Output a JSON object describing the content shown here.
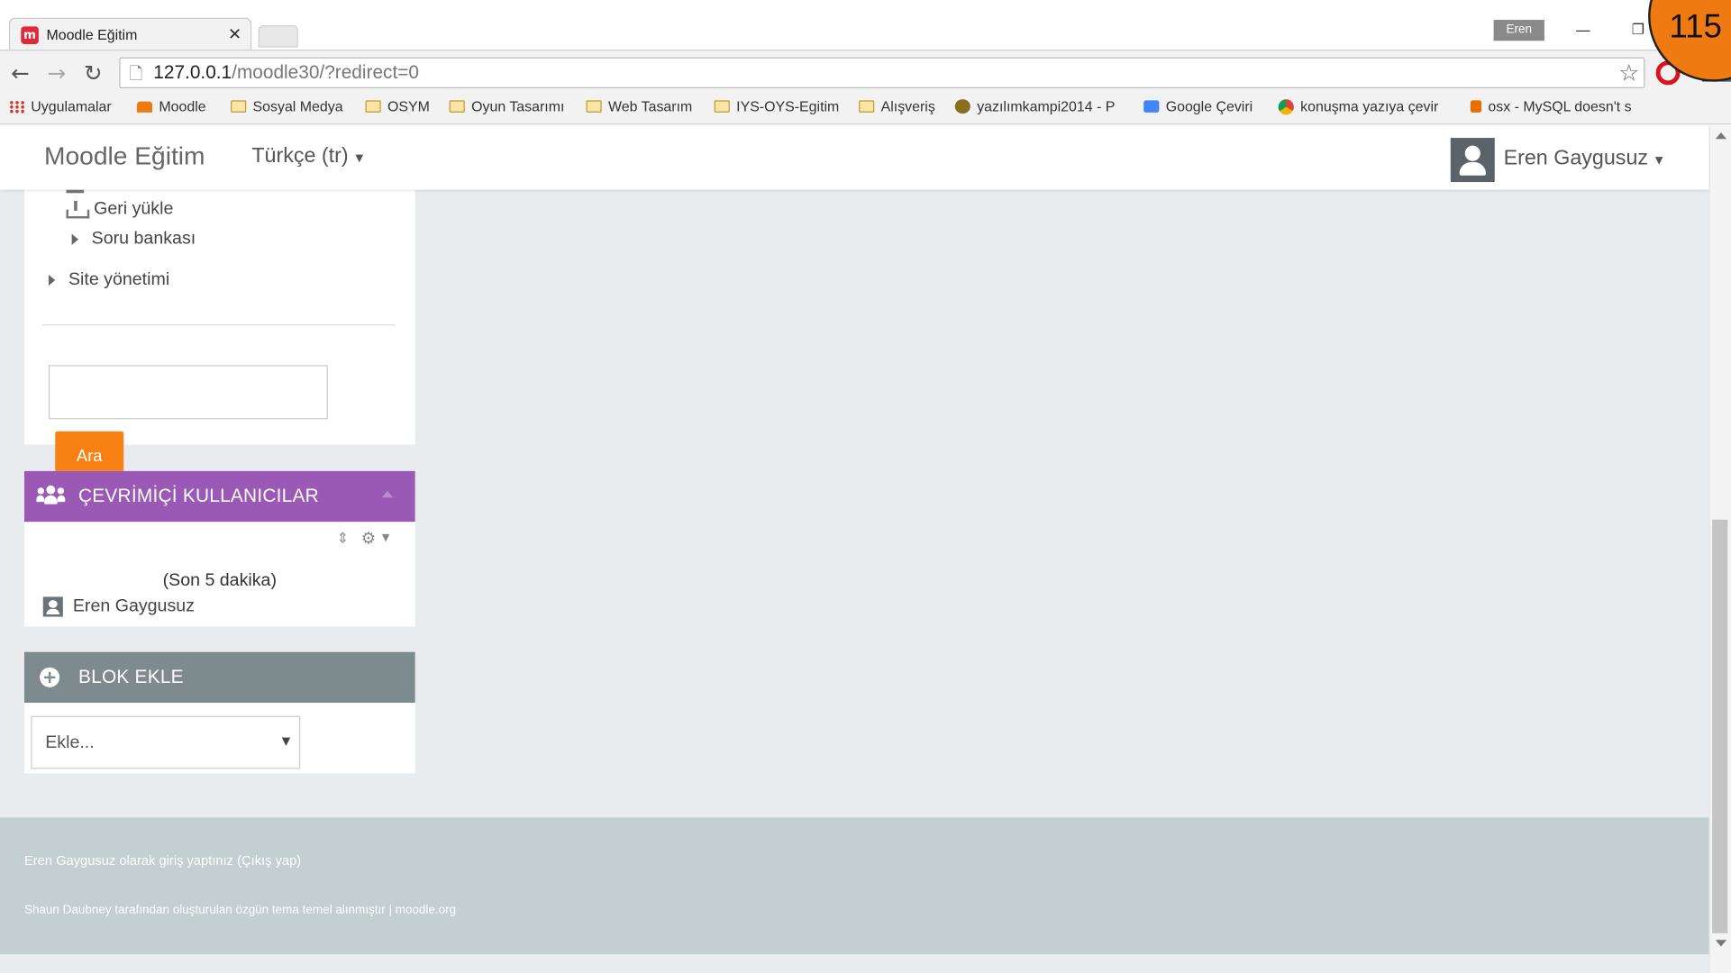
{
  "browser": {
    "tab_title": "Moodle Eğitim",
    "tab_favicon_letter": "m",
    "tab_close": "✕",
    "profile_name": "Eren",
    "window_min": "—",
    "window_max": "❐",
    "url_host": "127.0.0.1",
    "url_path": "/moodle30/?redirect=0",
    "nav_back": "←",
    "nav_forward": "→",
    "nav_reload": "↻",
    "bookmarks": [
      {
        "label": "Uygulamalar",
        "icon": "apps-grid-icon"
      },
      {
        "label": "Moodle",
        "icon": "moodle-icon"
      },
      {
        "label": "Sosyal Medya",
        "icon": "folder-icon"
      },
      {
        "label": "OSYM",
        "icon": "folder-icon"
      },
      {
        "label": "Oyun Tasarımı",
        "icon": "folder-icon"
      },
      {
        "label": "Web Tasarım",
        "icon": "folder-icon"
      },
      {
        "label": "IYS-OYS-Egitim",
        "icon": "folder-icon"
      },
      {
        "label": "Alışveriş",
        "icon": "folder-icon"
      },
      {
        "label": "yazılımkampi2014 - P",
        "icon": "bug-icon"
      },
      {
        "label": "Google Çeviri",
        "icon": "google-translate-icon"
      },
      {
        "label": "konuşma yazıya çevir",
        "icon": "chrome-icon"
      },
      {
        "label": "osx - MySQL doesn't s",
        "icon": "java-icon"
      }
    ]
  },
  "overlay": {
    "recording_number": "115",
    "color": "#f07a12"
  },
  "navbar": {
    "brand": "Moodle Eğitim",
    "language": "Türkçe (tr)",
    "user_name": "Eren Gaygusuz"
  },
  "admin_block": {
    "items": [
      {
        "label": "Geri yükle",
        "icon": "download-icon"
      },
      {
        "label": "Soru bankası",
        "icon": "expand-arrow-icon"
      },
      {
        "label": "Site yönetimi",
        "icon": "expand-arrow-icon"
      }
    ],
    "search_value": "",
    "search_button": "Ara",
    "accent": "#f98012"
  },
  "online_users": {
    "title": "ÇEVRİMİÇİ KULLANICILAR",
    "period": "(Son 5 dakika)",
    "users": [
      "Eren Gaygusuz"
    ],
    "header_color": "#9b59b6"
  },
  "add_block": {
    "title": "BLOK EKLE",
    "selected": "Ekle...",
    "header_color": "#7d8b8e"
  },
  "footer": {
    "login_info": "Eren Gaygusuz olarak giriş yaptınız (Çıkış yap)",
    "theme_info": "Shaun Daubney tarafından oluşturulan özgün tema temel alınmıştır | moodle.org"
  }
}
